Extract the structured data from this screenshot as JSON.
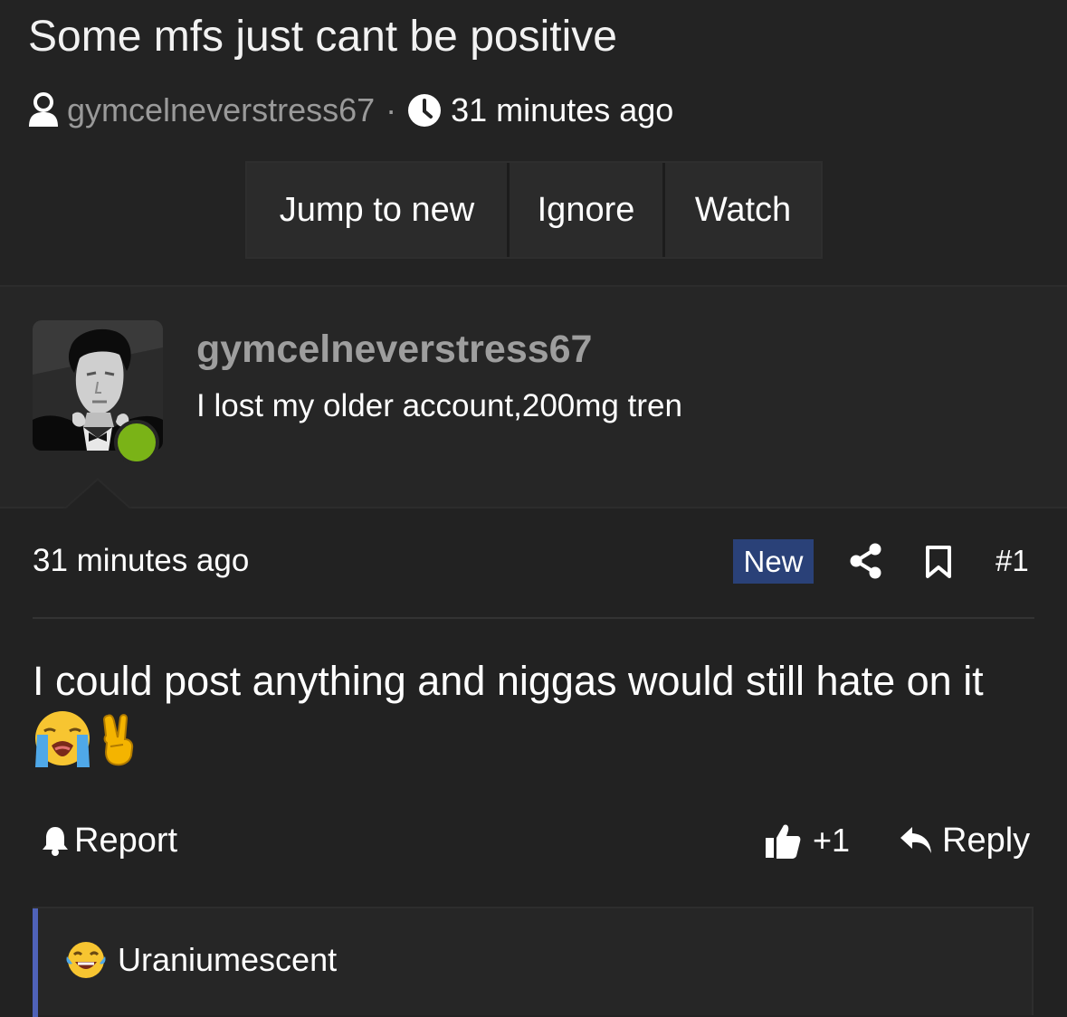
{
  "thread": {
    "title": "Some mfs just cant be positive",
    "author": "gymcelneverstress67",
    "separator": "·",
    "time": "31 minutes ago"
  },
  "buttons": {
    "jump_to_new": "Jump to new",
    "ignore": "Ignore",
    "watch": "Watch"
  },
  "user": {
    "name": "gymcelneverstress67",
    "title": "I lost my older account,200mg tren",
    "status": "online",
    "status_color": "#7ab317"
  },
  "post": {
    "time": "31 minutes ago",
    "badge": "New",
    "badge_color": "#2a4178",
    "number": "#1",
    "body": "I could post anything and niggas would still hate on it",
    "emojis": [
      "loudly-crying-face",
      "victory-hand"
    ]
  },
  "actions": {
    "report": "Report",
    "like_count": "+1",
    "reply": "Reply"
  },
  "quote": {
    "user": "Uraniumescent",
    "accent_color": "#4f62b8"
  }
}
